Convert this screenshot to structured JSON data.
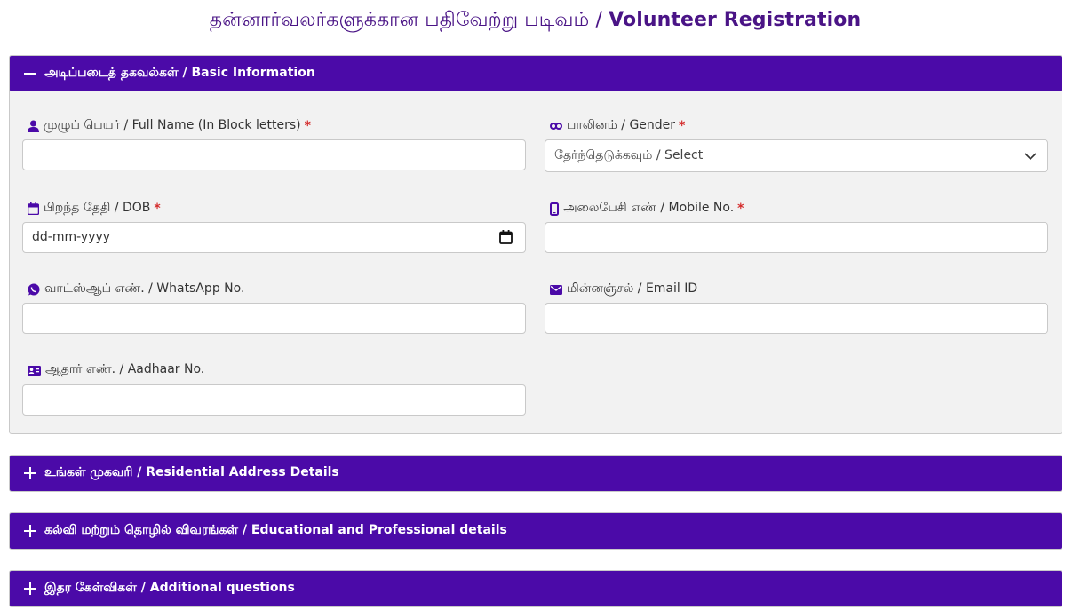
{
  "page": {
    "title_ta": "தன்னார்வலர்களுக்கான பதிவேற்று படிவம்",
    "title_sep": " / ",
    "title_en": "Volunteer Registration"
  },
  "sections": {
    "basic": {
      "title": "அடிப்படைத் தகவல்கள் / Basic Information",
      "expanded": true,
      "fields": {
        "full_name": {
          "label": "முழுப் பெயர் / Full Name (In Block letters)",
          "required": "*",
          "value": "",
          "icon": "user-icon"
        },
        "gender": {
          "label": "பாலினம் / Gender",
          "required": "*",
          "selected": "தேர்ந்தெடுக்கவும் / Select",
          "icon": "gender-icon"
        },
        "dob": {
          "label": "பிறந்த தேதி / DOB",
          "required": "*",
          "value": "dd-mm-yyyy",
          "icon": "calendar-icon"
        },
        "mobile": {
          "label": "அலைபேசி எண் / Mobile No.",
          "required": "*",
          "value": "",
          "icon": "mobile-icon"
        },
        "whatsapp": {
          "label": "வாட்ஸ்ஆப் எண். / WhatsApp No.",
          "value": "",
          "icon": "whatsapp-icon"
        },
        "email": {
          "label": "மின்னஞ்சல் / Email ID",
          "value": "",
          "icon": "envelope-icon"
        },
        "aadhaar": {
          "label": "ஆதார் எண். / Aadhaar No.",
          "value": "",
          "icon": "id-card-icon"
        }
      }
    },
    "address": {
      "title": "உங்கள் முகவரி / Residential Address Details",
      "expanded": false
    },
    "education": {
      "title": "கல்வி மற்றும் தொழில் விவரங்கள் / Educational and Professional details",
      "expanded": false
    },
    "additional": {
      "title": "இதர கேள்விகள் / Additional questions",
      "expanded": false
    }
  },
  "colors": {
    "header_bg": "#4b0aa8",
    "title_color": "#4a1486",
    "icon_color": "#4b0aa8",
    "required": "#d42b2b"
  }
}
